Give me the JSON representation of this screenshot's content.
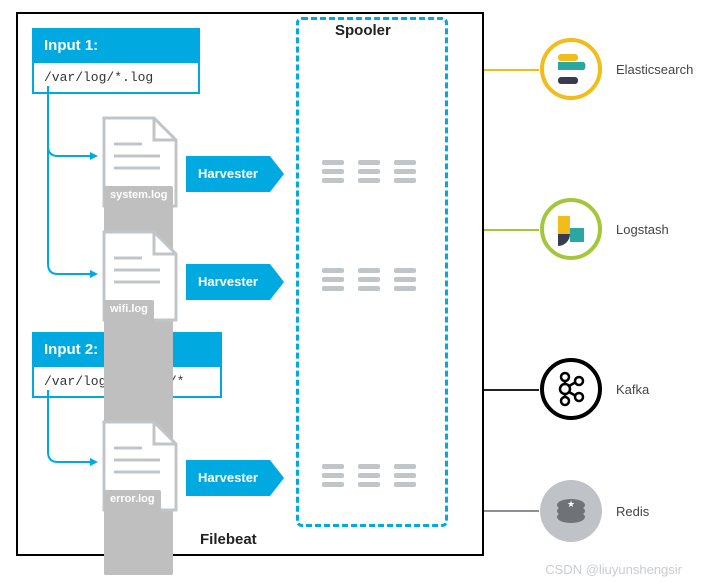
{
  "filebeat_title": "Filebeat",
  "spooler_title": "Spooler",
  "inputs": [
    {
      "title": "Input 1:",
      "path": "/var/log/*.log"
    },
    {
      "title": "Input 2:",
      "path": "/var/log/apache2/*"
    }
  ],
  "files": [
    {
      "name": "system.log"
    },
    {
      "name": "wifi.log"
    },
    {
      "name": "error.log"
    }
  ],
  "harvester_label": "Harvester",
  "outputs": [
    {
      "name": "Elasticsearch",
      "icon": "elasticsearch"
    },
    {
      "name": "Logstash",
      "icon": "logstash"
    },
    {
      "name": "Kafka",
      "icon": "kafka"
    },
    {
      "name": "Redis",
      "icon": "redis"
    }
  ],
  "credit": "CSDN @liuyunshengsir"
}
